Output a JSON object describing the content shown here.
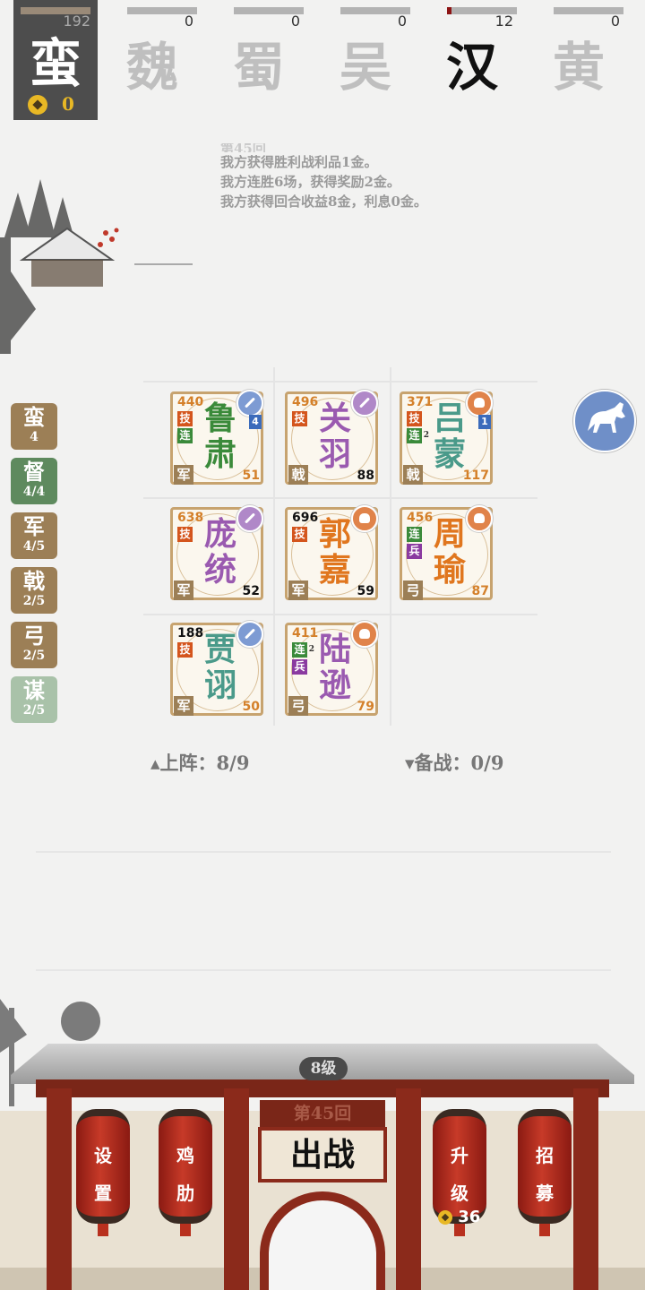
{
  "factions": [
    {
      "name": "蛮",
      "count": "192",
      "progress": 0,
      "gold": "0",
      "active": true
    },
    {
      "name": "魏",
      "count": "0",
      "progress": 0
    },
    {
      "name": "蜀",
      "count": "0",
      "progress": 0
    },
    {
      "name": "吴",
      "count": "0",
      "progress": 0
    },
    {
      "name": "汉",
      "count": "12",
      "progress": 0.06
    },
    {
      "name": "黄",
      "count": "0",
      "progress": 0
    }
  ],
  "log": {
    "partial_line": "第45回",
    "lines": [
      "我方获得胜利战利品1金。",
      "我方连胜6场，获得奖励2金。",
      "我方获得回合收益8金，利息0金。"
    ]
  },
  "traits": [
    {
      "label": "蛮",
      "count": "4",
      "color": "#9c7f56"
    },
    {
      "label": "督",
      "count": "4/4",
      "color": "#5e8a5e"
    },
    {
      "label": "军",
      "count": "4/5",
      "color": "#9c7f56"
    },
    {
      "label": "戟",
      "count": "2/5",
      "color": "#9c7f56"
    },
    {
      "label": "弓",
      "count": "2/5",
      "color": "#9c7f56"
    },
    {
      "label": "谋",
      "count": "2/5",
      "color": "#a9c2a9"
    }
  ],
  "heroes": [
    {
      "name1": "鲁",
      "name2": "肃",
      "hp": "440",
      "power": "51",
      "type": "军",
      "tags": [
        "技",
        "连"
      ],
      "badge": "weapon",
      "stars": "4",
      "name_color": "#3a8a3a",
      "hp_color": "#d4802a",
      "power_color": "#d4802a"
    },
    {
      "name1": "关",
      "name2": "羽",
      "hp": "496",
      "power": "88",
      "type": "戟",
      "tags": [
        "技"
      ],
      "badge": "wand",
      "stars": "",
      "name_color": "#9a5ab0",
      "hp_color": "#d4802a",
      "power_color": "#111111"
    },
    {
      "name1": "吕",
      "name2": "蒙",
      "hp": "371",
      "power": "117",
      "type": "戟",
      "tags": [
        "技",
        "连2"
      ],
      "badge": "bag",
      "stars": "1",
      "name_color": "#4a9a8a",
      "hp_color": "#d4802a",
      "power_color": "#d4802a"
    },
    {
      "name1": "庞",
      "name2": "统",
      "hp": "638",
      "power": "52",
      "type": "军",
      "tags": [
        "技"
      ],
      "badge": "wand",
      "stars": "",
      "name_color": "#9a5ab0",
      "hp_color": "#d4802a",
      "power_color": "#111111"
    },
    {
      "name1": "郭",
      "name2": "嘉",
      "hp": "696",
      "power": "59",
      "type": "军",
      "tags": [
        "技"
      ],
      "badge": "bag",
      "stars": "",
      "name_color": "#e0761e",
      "hp_color": "#111111",
      "power_color": "#111111"
    },
    {
      "name1": "周",
      "name2": "瑜",
      "hp": "456",
      "power": "87",
      "type": "弓",
      "tags": [
        "连",
        "兵"
      ],
      "badge": "bag",
      "stars": "",
      "name_color": "#e0761e",
      "hp_color": "#d4802a",
      "power_color": "#d4802a"
    },
    {
      "name1": "贾",
      "name2": "诩",
      "hp": "188",
      "power": "50",
      "type": "军",
      "tags": [
        "技"
      ],
      "badge": "weapon",
      "stars": "",
      "name_color": "#4a9a8a",
      "hp_color": "#111111",
      "power_color": "#d4802a"
    },
    {
      "name1": "陆",
      "name2": "逊",
      "hp": "411",
      "power": "79",
      "type": "弓",
      "tags": [
        "连2",
        "兵"
      ],
      "badge": "bag",
      "stars": "",
      "name_color": "#9a5ab0",
      "hp_color": "#d4802a",
      "power_color": "#d4802a"
    }
  ],
  "counters": {
    "on_field": "▴上阵：8/9",
    "bench": "▾备战：0/9"
  },
  "building": {
    "level": "8级",
    "round": "第45回",
    "fight": "出战",
    "settings": [
      "设",
      "置"
    ],
    "chicken": [
      "鸡",
      "肋"
    ],
    "upgrade": [
      "升",
      "级"
    ],
    "upgrade_cost": "36",
    "recruit": [
      "招",
      "募"
    ]
  },
  "icons": {
    "horse": "horse-icon",
    "gold": "coin-icon"
  }
}
